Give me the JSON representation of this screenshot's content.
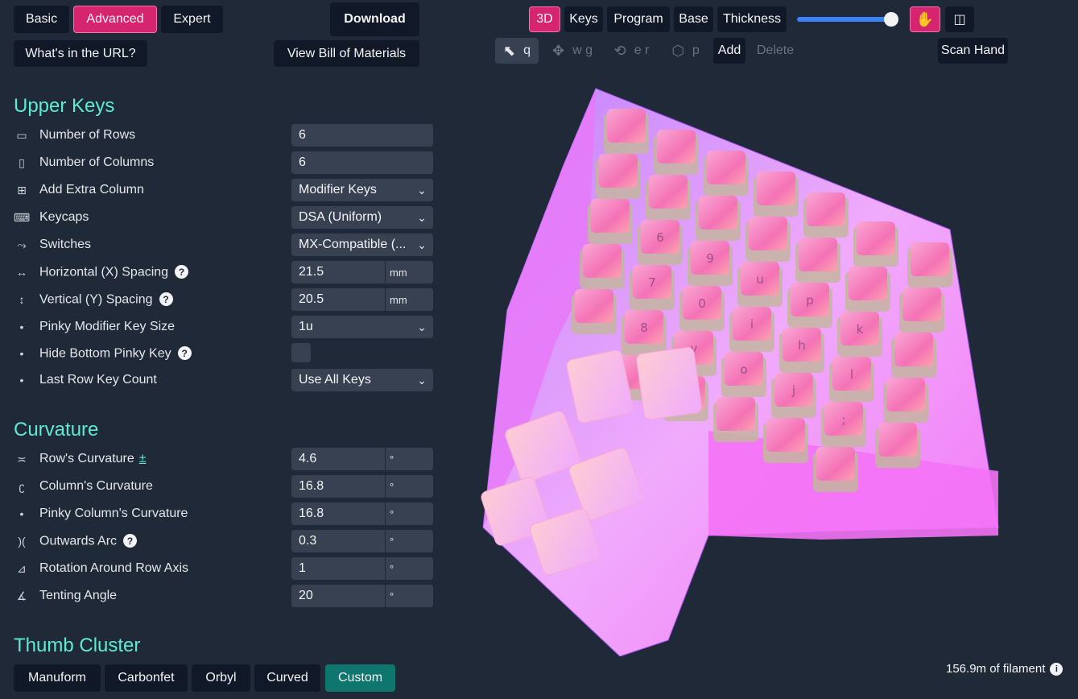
{
  "mode_tabs": [
    {
      "label": "Basic",
      "active": false
    },
    {
      "label": "Advanced",
      "active": true
    },
    {
      "label": "Expert",
      "active": false
    }
  ],
  "download_label": "Download",
  "url_button_label": "What's in the URL?",
  "bom_button_label": "View Bill of Materials",
  "view_tabs": [
    {
      "label": "3D",
      "active": true
    },
    {
      "label": "Keys",
      "active": false
    },
    {
      "label": "Program",
      "active": false
    },
    {
      "label": "Base",
      "active": false
    },
    {
      "label": "Thickness",
      "active": false
    }
  ],
  "tools": {
    "select_key": "q",
    "move_keys": "w g",
    "rotate_keys": "e r",
    "plate_key": "p",
    "add_label": "Add",
    "delete_label": "Delete"
  },
  "scan_hand_label": "Scan Hand",
  "sections": {
    "upper_keys": "Upper Keys",
    "curvature": "Curvature",
    "thumb_cluster": "Thumb Cluster"
  },
  "upper_keys": [
    {
      "label": "Number of Rows",
      "icon": "rows-icon",
      "glyph": "▭",
      "type": "input",
      "value": "6"
    },
    {
      "label": "Number of Columns",
      "icon": "columns-icon",
      "glyph": "▯",
      "type": "input",
      "value": "6"
    },
    {
      "label": "Add Extra Column",
      "icon": "add-column-icon",
      "glyph": "⊞",
      "type": "select",
      "value": "Modifier Keys"
    },
    {
      "label": "Keycaps",
      "icon": "keycap-icon",
      "glyph": "⌨",
      "type": "select",
      "value": "DSA (Uniform)"
    },
    {
      "label": "Switches",
      "icon": "switch-icon",
      "glyph": "⤳",
      "type": "select",
      "value": "MX-Compatible (..."
    },
    {
      "label": "Horizontal (X) Spacing",
      "icon": "horizontal-spacing-icon",
      "glyph": "↔",
      "type": "unit",
      "value": "21.5",
      "unit": "mm",
      "help": true
    },
    {
      "label": "Vertical (Y) Spacing",
      "icon": "vertical-spacing-icon",
      "glyph": "↕",
      "type": "unit",
      "value": "20.5",
      "unit": "mm",
      "help": true
    },
    {
      "label": "Pinky Modifier Key Size",
      "icon": "dot-icon",
      "glyph": "•",
      "type": "select",
      "value": "1u"
    },
    {
      "label": "Hide Bottom Pinky Key",
      "icon": "dot-icon",
      "glyph": "•",
      "type": "checkbox",
      "checked": false,
      "help": true
    },
    {
      "label": "Last Row Key Count",
      "icon": "dot-icon",
      "glyph": "•",
      "type": "select",
      "value": "Use All Keys"
    }
  ],
  "curvature": [
    {
      "label": "Row's Curvature",
      "icon": "row-curvature-icon",
      "glyph": "≍",
      "value": "4.6",
      "unit": "°",
      "plusminus": "±"
    },
    {
      "label": "Column's Curvature",
      "icon": "column-curvature-icon",
      "glyph": "ʗ",
      "value": "16.8",
      "unit": "°"
    },
    {
      "label": "Pinky Column's Curvature",
      "icon": "dot-icon",
      "glyph": "•",
      "value": "16.8",
      "unit": "°"
    },
    {
      "label": "Outwards Arc",
      "icon": "outwards-arc-icon",
      "glyph": ")(",
      "value": "0.3",
      "unit": "°",
      "help": true
    },
    {
      "label": "Rotation Around Row Axis",
      "icon": "rotation-icon",
      "glyph": "⊿",
      "value": "1",
      "unit": "°"
    },
    {
      "label": "Tenting Angle",
      "icon": "tenting-icon",
      "glyph": "∡",
      "value": "20",
      "unit": "°"
    }
  ],
  "thumb_tabs": [
    {
      "label": "Manuform",
      "active": false
    },
    {
      "label": "Carbonfet",
      "active": false
    },
    {
      "label": "Orbyl",
      "active": false
    },
    {
      "label": "Curved",
      "active": false
    },
    {
      "label": "Custom",
      "active": true
    }
  ],
  "filament_text": "156.9m of filament",
  "key_legends": [
    "6",
    "7",
    "8",
    "9",
    "0",
    "y",
    "u",
    "i",
    "o",
    "p",
    "h",
    "j",
    "k",
    "l",
    ";"
  ],
  "colors": {
    "accent": "#d6256f",
    "section_title": "#5eead4",
    "case_pink": "#f472f6",
    "keycap_pink": "#f472b6",
    "slider": "#3b82f6"
  }
}
